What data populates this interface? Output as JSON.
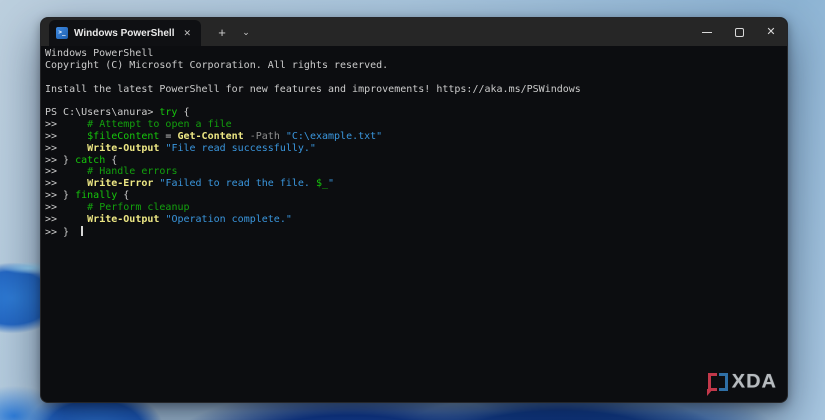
{
  "window": {
    "tab": {
      "title": "Windows PowerShell",
      "icon_glyph": ">_",
      "close_glyph": "✕"
    },
    "new_tab_glyph": "+",
    "dropdown_glyph": "⌄",
    "controls": {
      "close_glyph": "✕"
    }
  },
  "colors": {
    "fg": "#CCCCCC",
    "kw": "#16C60C",
    "cm": "#13A10E",
    "var": "#16C60C",
    "cmd": "#EDE784",
    "str": "#3A96DD",
    "param": "#8F8F8F",
    "terminal_bg": "#0C0D10"
  },
  "terminal": {
    "lines": [
      {
        "segments": [
          {
            "t": "Windows PowerShell",
            "c": "fg"
          }
        ]
      },
      {
        "segments": [
          {
            "t": "Copyright (C) Microsoft Corporation. All rights reserved.",
            "c": "fg"
          }
        ]
      },
      {
        "segments": [
          {
            "t": " ",
            "c": "fg"
          }
        ]
      },
      {
        "segments": [
          {
            "t": "Install the latest PowerShell for new features and improvements! https://aka.ms/PSWindows",
            "c": "fg"
          }
        ]
      },
      {
        "segments": [
          {
            "t": " ",
            "c": "fg"
          }
        ]
      },
      {
        "segments": [
          {
            "t": "PS C:\\Users\\anura> ",
            "c": "fg"
          },
          {
            "t": "try",
            "c": "kw"
          },
          {
            "t": " {",
            "c": "fg"
          }
        ]
      },
      {
        "segments": [
          {
            "t": ">>     ",
            "c": "fg"
          },
          {
            "t": "# Attempt to open a file",
            "c": "cm"
          }
        ]
      },
      {
        "segments": [
          {
            "t": ">>     ",
            "c": "fg"
          },
          {
            "t": "$fileContent",
            "c": "var"
          },
          {
            "t": " = ",
            "c": "fg"
          },
          {
            "t": "Get-Content",
            "c": "cmd"
          },
          {
            "t": " ",
            "c": "fg"
          },
          {
            "t": "-Path",
            "c": "param"
          },
          {
            "t": " ",
            "c": "fg"
          },
          {
            "t": "\"C:\\example.txt\"",
            "c": "str"
          }
        ]
      },
      {
        "segments": [
          {
            "t": ">>     ",
            "c": "fg"
          },
          {
            "t": "Write-Output",
            "c": "cmd"
          },
          {
            "t": " ",
            "c": "fg"
          },
          {
            "t": "\"File read successfully.\"",
            "c": "str"
          }
        ]
      },
      {
        "segments": [
          {
            "t": ">> } ",
            "c": "fg"
          },
          {
            "t": "catch",
            "c": "kw"
          },
          {
            "t": " {",
            "c": "fg"
          }
        ]
      },
      {
        "segments": [
          {
            "t": ">>     ",
            "c": "fg"
          },
          {
            "t": "# Handle errors",
            "c": "cm"
          }
        ]
      },
      {
        "segments": [
          {
            "t": ">>     ",
            "c": "fg"
          },
          {
            "t": "Write-Error",
            "c": "cmd"
          },
          {
            "t": " ",
            "c": "fg"
          },
          {
            "t": "\"Failed to read the file. ",
            "c": "str"
          },
          {
            "t": "$_",
            "c": "var"
          },
          {
            "t": "\"",
            "c": "str"
          }
        ]
      },
      {
        "segments": [
          {
            "t": ">> } ",
            "c": "fg"
          },
          {
            "t": "finally",
            "c": "kw"
          },
          {
            "t": " {",
            "c": "fg"
          }
        ]
      },
      {
        "segments": [
          {
            "t": ">>     ",
            "c": "fg"
          },
          {
            "t": "# Perform cleanup",
            "c": "cm"
          }
        ]
      },
      {
        "segments": [
          {
            "t": ">>     ",
            "c": "fg"
          },
          {
            "t": "Write-Output",
            "c": "cmd"
          },
          {
            "t": " ",
            "c": "fg"
          },
          {
            "t": "\"Operation complete.\"",
            "c": "str"
          }
        ]
      },
      {
        "segments": [
          {
            "t": ">> }  ",
            "c": "fg"
          }
        ],
        "cursor": true
      }
    ]
  },
  "xda": {
    "text": "XDA"
  }
}
